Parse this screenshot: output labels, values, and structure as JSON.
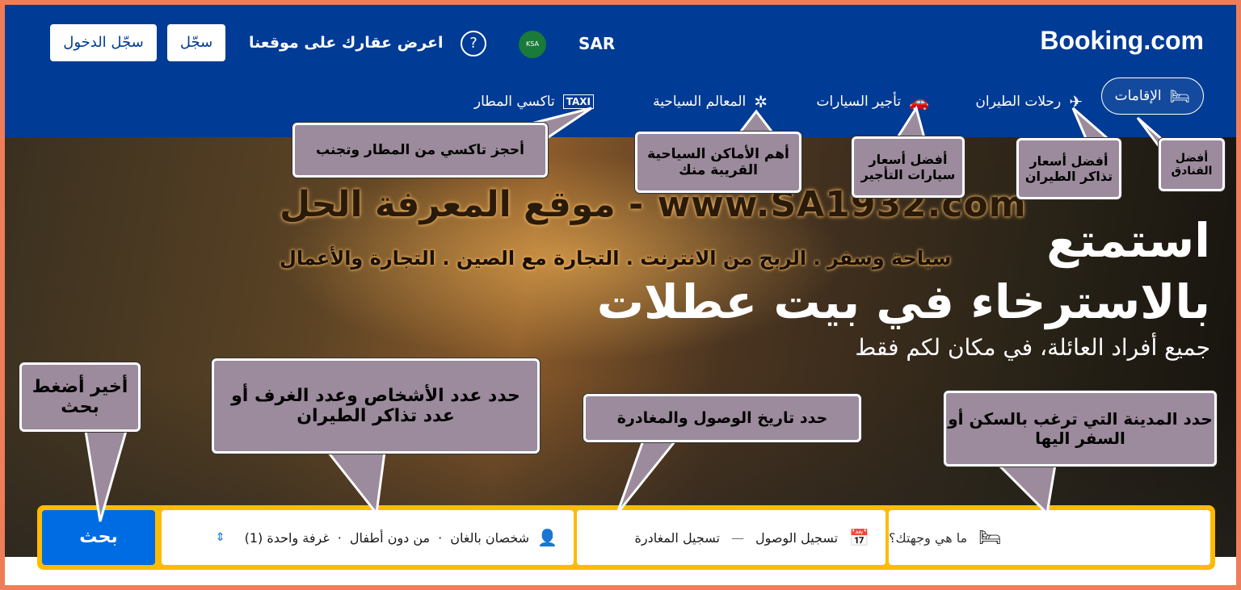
{
  "header": {
    "logo": "Booking.com",
    "currency": "SAR",
    "flag_label": "KSA",
    "help_symbol": "?",
    "list_property": "اعرض عقارك على موقعنا",
    "register": "سجّل",
    "sign_in": "سجّل الدخول"
  },
  "nav": {
    "stays": "الإقامات",
    "flights": "رحلات الطيران",
    "car_rentals": "تأجير السيارات",
    "attractions": "المعالم السياحية",
    "airport_taxi": "تاكسي المطار"
  },
  "hero": {
    "title_line1": "استمتع",
    "title_line2": "بالاسترخاء في بيت عطلات",
    "subtitle": "جميع أفراد العائلة، في مكان لكم فقط",
    "watermark_line1": "www.SA1932.com - موقع المعرفة الحل",
    "watermark_line2": "سياحة وسفر . الربح من الانترنت . التجارة مع الصين . التجارة والأعمال"
  },
  "search": {
    "destination_placeholder": "ما هي وجهتك؟",
    "checkin": "تسجيل الوصول",
    "dash": "—",
    "checkout": "تسجيل المغادرة",
    "adults": "شخصان بالغان",
    "children": "من دون أطفال",
    "rooms": "غرفة واحدة (1)",
    "dot": "·",
    "button": "بحث"
  },
  "callouts": {
    "hotels": "أفضل الفنادق",
    "flights": "أفضل أسعار تذاكر الطيران",
    "cars": "أفضل أسعار سيارات التأجير",
    "places": "أهم الأماكن السياحية القريبة منك",
    "taxi": "أحجز تاكسي من المطار وتجنب",
    "city": "حدد المدينة التي ترغب بالسكن أو السفر اليها",
    "dates": "حدد تاريخ الوصول والمغادرة",
    "guests": "حدد عدد الأشخاص وعدد الغرف أو عدد تذاكر الطيران",
    "search": "أخير أضغط بحث"
  }
}
